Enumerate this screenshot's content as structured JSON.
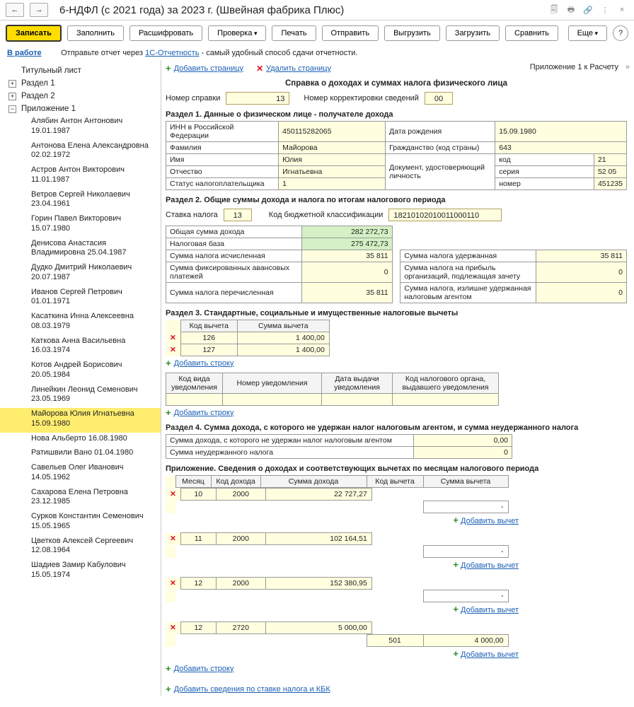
{
  "header": {
    "title": "6-НДФЛ (с 2021 года) за 2023 г. (Швейная фабрика Плюс)"
  },
  "toolbar": {
    "write": "Записать",
    "fill": "Заполнить",
    "decode": "Расшифровать",
    "check": "Проверка",
    "print": "Печать",
    "send": "Отправить",
    "export": "Выгрузить",
    "import": "Загрузить",
    "compare": "Сравнить",
    "more": "Еще",
    "help": "?"
  },
  "status": {
    "in_work": "В работе",
    "send_via": "Отправьте отчет через ",
    "link": "1С-Отчетность",
    "tail": " - самый удобный способ сдачи отчетности."
  },
  "tree": {
    "title_sheet": "Титульный лист",
    "section1": "Раздел 1",
    "section2": "Раздел 2",
    "appendix1": "Приложение 1",
    "leaves": [
      "Алябин Антон Антонович 19.01.1987",
      "Антонова Елена Александровна 02.02.1972",
      "Астров Антон Викторович 11.01.1987",
      "Ветров Сергей Николаевич 23.04.1961",
      "Горин Павел Викторович 15.07.1980",
      "Денисова Анастасия Владимировна 25.04.1987",
      "Дудко Дмитрий Николаевич 20.07.1987",
      "Иванов Сергей Петрович 01.01.1971",
      "Касаткина Инна Алексеевна 08.03.1979",
      "Каткова Анна Васильевна 16.03.1974",
      "Котов Андрей Борисович 20.05.1984",
      "Линейкин Леонид Семенович 23.05.1969",
      "Майорова Юлия Игнатьевна 15.09.1980",
      "Нова Альберто 16.08.1980",
      "Ратишвили Вано 01.04.1980",
      "Савельев Олег Иванович 14.05.1962",
      "Сахарова Елена Петровна 23.12.1985",
      "Сурков Константин Семенович 15.05.1965",
      "Цветков Алексей Сергеевич 12.08.1964",
      "Шадиев Замир Кабулович 15.05.1974"
    ]
  },
  "page": {
    "add_page": "Добавить страницу",
    "del_page": "Удалить страницу",
    "app_title": "Приложение 1 к Расчету",
    "doc_title": "Справка о доходах и суммах налога физического лица",
    "ref_num_lbl": "Номер справки",
    "ref_num": "13",
    "corr_lbl": "Номер корректировки сведений",
    "corr": "00"
  },
  "s1": {
    "head": "Раздел 1. Данные о физическом лице - получателе дохода",
    "inn_lbl": "ИНН в Российской Федерации",
    "inn": "450115282065",
    "birth_lbl": "Дата рождения",
    "birth": "15.09.1980",
    "fam_lbl": "Фамилия",
    "fam": "Майорова",
    "citizen_lbl": "Гражданство (код страны)",
    "citizen": "643",
    "name_lbl": "Имя",
    "name": "Юлия",
    "doc_lbl": "Документ, удостоверяющий личность",
    "code_lbl": "код",
    "code": "21",
    "patr_lbl": "Отчество",
    "patr": "Игнатьевна",
    "ser_lbl": "серия",
    "ser": "52 05",
    "status_lbl": "Статус налогоплательщика",
    "status": "1",
    "num_lbl": "номер",
    "num": "451235"
  },
  "s2": {
    "head": "Раздел 2. Общие суммы дохода и налога по итогам налогового периода",
    "rate_lbl": "Ставка налога",
    "rate": "13",
    "kbk_lbl": "Код бюджетной классификации",
    "kbk": "18210102010011000110",
    "r1l": "Общая сумма дохода",
    "r1v": "282 272,73",
    "r2l": "Налоговая база",
    "r2v": "275 472,73",
    "r3l": "Сумма налога исчисленная",
    "r3v": "35 811",
    "r3l2": "Сумма налога удержанная",
    "r3v2": "35 811",
    "r4l": "Сумма фиксированных авансовых платежей",
    "r4v": "0",
    "r4l2": "Сумма налога на прибыль организаций, подлежащая зачету",
    "r4v2": "0",
    "r5l": "Сумма налога перечисленная",
    "r5v": "35 811",
    "r5l2": "Сумма налога, излишне удержанная налоговым агентом",
    "r5v2": "0"
  },
  "s3": {
    "head": "Раздел 3. Стандартные, социальные и имущественные налоговые вычеты",
    "h1": "Код вычета",
    "h2": "Сумма вычета",
    "rows": [
      {
        "code": "126",
        "sum": "1 400,00"
      },
      {
        "code": "127",
        "sum": "1 400,00"
      }
    ],
    "add_row": "Добавить строку",
    "n_h1": "Код вида уведомления",
    "n_h2": "Номер уведомления",
    "n_h3": "Дата выдачи уведомления",
    "n_h4": "Код налогового органа, выдавшего уведомления"
  },
  "s4": {
    "head": "Раздел 4. Сумма дохода, с которого не удержан налог налоговым агентом, и сумма неудержанного налога",
    "r1": "Сумма дохода, с которого не удержан налог налоговым агентом",
    "r1v": "0,00",
    "r2": "Сумма неудержанного налога",
    "r2v": "0"
  },
  "app": {
    "head": "Приложение. Сведения о доходах и соответствующих вычетах по месяцам налогового периода",
    "h1": "Месяц",
    "h2": "Код дохода",
    "h3": "Сумма дохода",
    "h4": "Код вычета",
    "h5": "Сумма вычета",
    "rows": [
      {
        "m": "10",
        "code": "2000",
        "sum": "22 727,27"
      },
      {
        "m": "11",
        "code": "2000",
        "sum": "102 164,51"
      },
      {
        "m": "12",
        "code": "2000",
        "sum": "152 380,95"
      },
      {
        "m": "12",
        "code": "2720",
        "sum": "5 000,00",
        "dc": "501",
        "ds": "4 000,00"
      }
    ],
    "dash": "-",
    "add_deduct": "Добавить вычет",
    "add_row": "Добавить строку",
    "add_kbk": "Добавить сведения по ставке налога и КБК"
  }
}
